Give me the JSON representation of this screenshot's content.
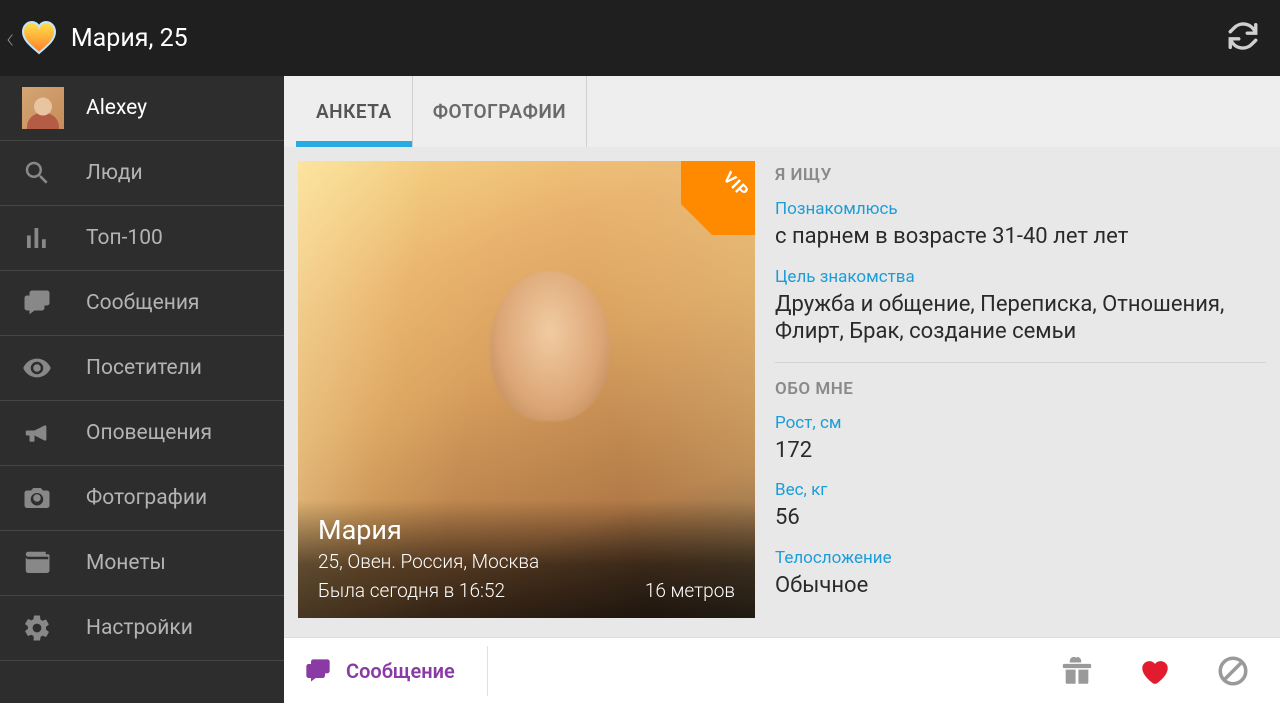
{
  "header": {
    "title": "Мария, 25"
  },
  "sidebar": {
    "user": "Alexey",
    "items": [
      {
        "label": "Люди",
        "icon": "search"
      },
      {
        "label": "Топ-100",
        "icon": "chart"
      },
      {
        "label": "Сообщения",
        "icon": "messages"
      },
      {
        "label": "Посетители",
        "icon": "eye"
      },
      {
        "label": "Оповещения",
        "icon": "megaphone"
      },
      {
        "label": "Фотографии",
        "icon": "camera"
      },
      {
        "label": "Монеты",
        "icon": "wallet"
      },
      {
        "label": "Настройки",
        "icon": "gear"
      }
    ]
  },
  "tabs": {
    "profile": "АНКЕТА",
    "photos": "ФОТОГРАФИИ"
  },
  "photo": {
    "vip": "VIP",
    "name": "Мария",
    "detail": "25, Овен. Россия, Москва",
    "last_seen": "Была сегодня в 16:52",
    "distance": "16 метров"
  },
  "info": {
    "seeking_section": "Я ИЩУ",
    "seeking_label": "Познакомлюсь",
    "seeking_text": "с парнем в возрасте 31-40 лет лет",
    "purpose_label": "Цель знакомства",
    "purpose_text": "Дружба и общение, Переписка, Отношения, Флирт, Брак, создание семьи",
    "about_section": "ОБО МНЕ",
    "height_label": "Рост, см",
    "height_value": "172",
    "weight_label": "Вес, кг",
    "weight_value": "56",
    "body_label": "Телосложение",
    "body_value": "Обычное"
  },
  "actions": {
    "message": "Сообщение"
  }
}
